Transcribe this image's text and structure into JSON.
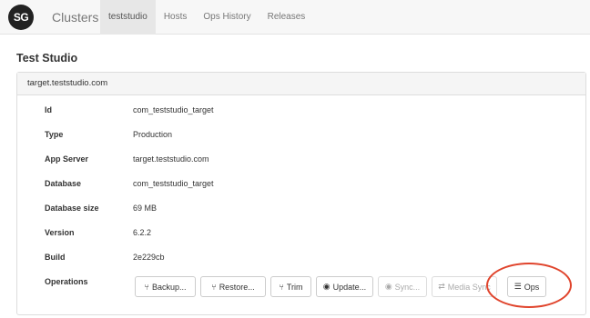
{
  "nav": {
    "logo_text": "SG",
    "brand": "Clusters",
    "items": [
      {
        "label": "teststudio",
        "active": true
      },
      {
        "label": "Hosts",
        "active": false
      },
      {
        "label": "Ops History",
        "active": false
      },
      {
        "label": "Releases",
        "active": false
      }
    ]
  },
  "page_title": "Test Studio",
  "panel": {
    "heading": "target.teststudio.com",
    "rows": [
      {
        "key": "Id",
        "value": "com_teststudio_target"
      },
      {
        "key": "Type",
        "value": "Production"
      },
      {
        "key": "App Server",
        "value": "target.teststudio.com"
      },
      {
        "key": "Database",
        "value": "com_teststudio_target"
      },
      {
        "key": "Database size",
        "value": "69 MB"
      },
      {
        "key": "Version",
        "value": "6.2.2"
      },
      {
        "key": "Build",
        "value": "2e229cb"
      }
    ],
    "operations_label": "Operations",
    "operations": [
      {
        "label": "Backup...",
        "icon": "branch-icon",
        "disabled": false
      },
      {
        "label": "Restore...",
        "icon": "branch-icon",
        "disabled": false
      },
      {
        "label": "Trim",
        "icon": "branch-icon",
        "disabled": false
      },
      {
        "label": "Update...",
        "icon": "circle-arrow-icon",
        "disabled": false
      },
      {
        "label": "Sync...",
        "icon": "circle-arrow-icon",
        "disabled": true
      },
      {
        "label": "Media Sync",
        "icon": "swap-arrows-icon",
        "disabled": true
      },
      {
        "label": "Ops",
        "icon": "list-icon",
        "disabled": false
      }
    ]
  },
  "colors": {
    "highlight": "#e0442c",
    "navbar_bg": "#f7f7f7",
    "panel_heading_bg": "#f5f5f5"
  }
}
